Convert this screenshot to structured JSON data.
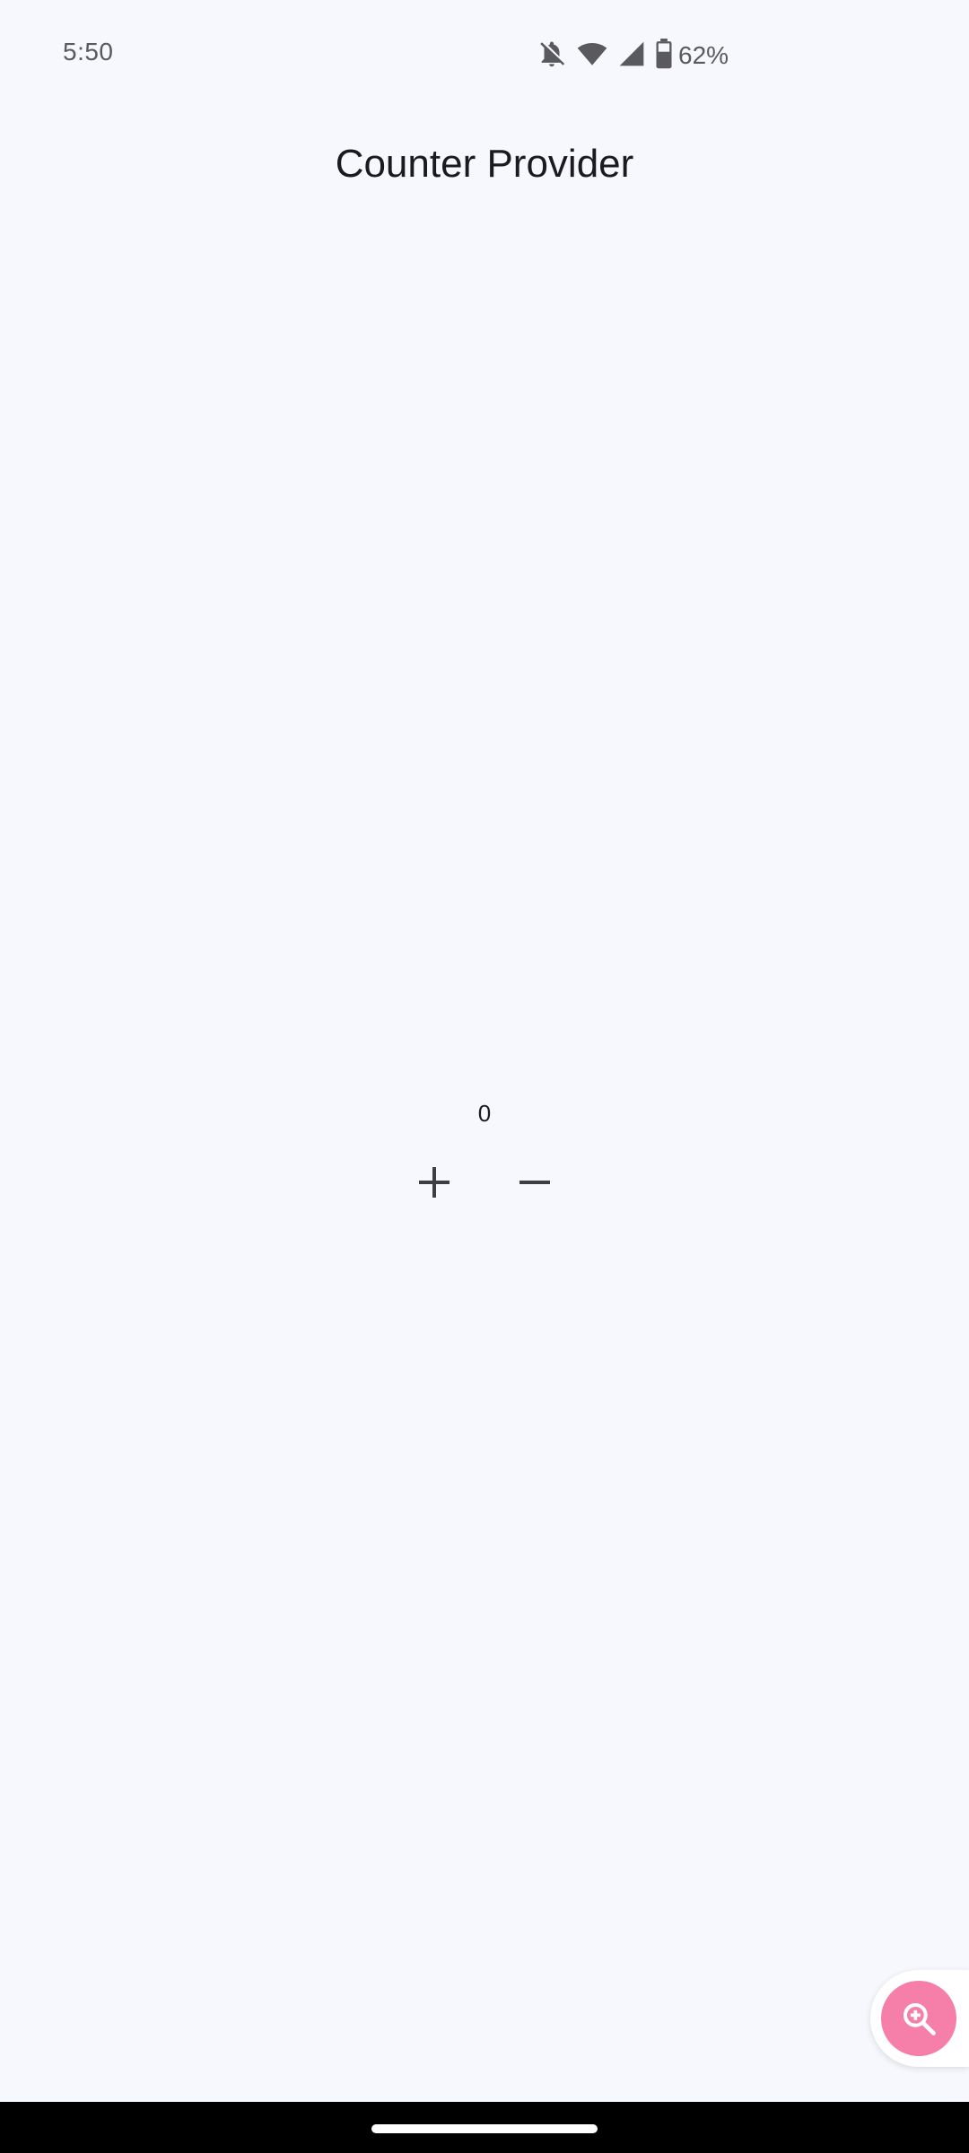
{
  "status_bar": {
    "time": "5:50",
    "battery_percent": "62%",
    "icons": [
      "notifications-off-icon",
      "wifi-icon",
      "cell-signal-icon",
      "battery-icon"
    ]
  },
  "app_bar": {
    "title": "Counter Provider"
  },
  "counter": {
    "value": "0",
    "increment_icon": "plus-icon",
    "decrement_icon": "minus-icon"
  },
  "floating_button": {
    "icon": "zoom-in-icon",
    "color": "#f57fa8"
  },
  "colors": {
    "background": "#f7f8fd",
    "text": "#1b1b1f",
    "icon": "#3d3d42"
  }
}
